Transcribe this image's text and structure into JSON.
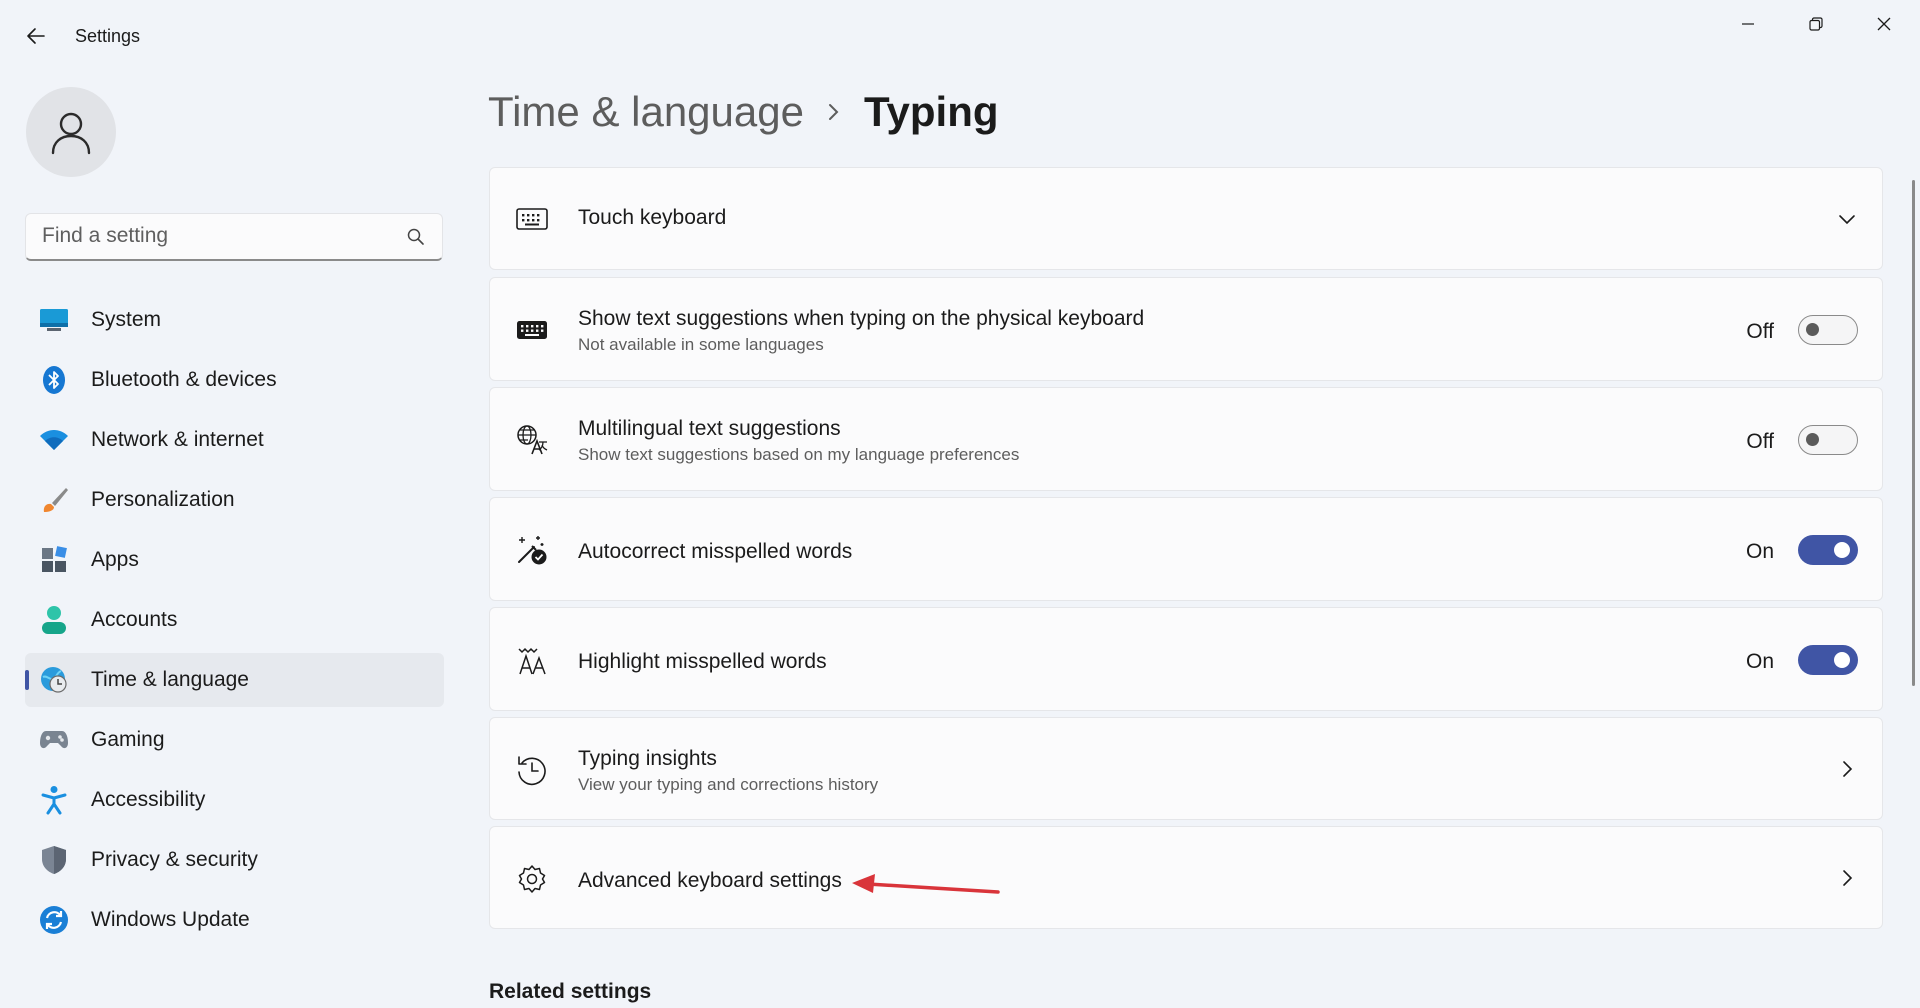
{
  "window": {
    "title": "Settings",
    "controls": [
      "minimize",
      "maximize",
      "close"
    ]
  },
  "search": {
    "placeholder": "Find a setting"
  },
  "sidebar": {
    "active": "Time & language",
    "items": [
      {
        "label": "System",
        "icon": "system-icon"
      },
      {
        "label": "Bluetooth & devices",
        "icon": "bluetooth-icon"
      },
      {
        "label": "Network & internet",
        "icon": "wifi-icon"
      },
      {
        "label": "Personalization",
        "icon": "brush-icon"
      },
      {
        "label": "Apps",
        "icon": "apps-icon"
      },
      {
        "label": "Accounts",
        "icon": "accounts-icon"
      },
      {
        "label": "Time & language",
        "icon": "time-language-icon"
      },
      {
        "label": "Gaming",
        "icon": "gamepad-icon"
      },
      {
        "label": "Accessibility",
        "icon": "accessibility-icon"
      },
      {
        "label": "Privacy & security",
        "icon": "shield-icon"
      },
      {
        "label": "Windows Update",
        "icon": "update-icon"
      }
    ]
  },
  "breadcrumb": {
    "parent": "Time & language",
    "current": "Typing"
  },
  "settings": [
    {
      "title": "Touch keyboard",
      "icon": "touch-keyboard-icon",
      "control": "expand"
    },
    {
      "title": "Show text suggestions when typing on the physical keyboard",
      "subtitle": "Not available in some languages",
      "icon": "keyboard-icon",
      "control": "toggle",
      "state": "Off"
    },
    {
      "title": "Multilingual text suggestions",
      "subtitle": "Show text suggestions based on my language preferences",
      "icon": "language-icon",
      "control": "toggle",
      "state": "Off"
    },
    {
      "title": "Autocorrect misspelled words",
      "icon": "autocorrect-icon",
      "control": "toggle",
      "state": "On"
    },
    {
      "title": "Highlight misspelled words",
      "icon": "highlight-spelling-icon",
      "control": "toggle",
      "state": "On"
    },
    {
      "title": "Typing insights",
      "subtitle": "View your typing and corrections history",
      "icon": "history-icon",
      "control": "chevron"
    },
    {
      "title": "Advanced keyboard settings",
      "icon": "gear-icon",
      "control": "chevron"
    }
  ],
  "related": {
    "heading": "Related settings"
  },
  "colors": {
    "accent": "#4055a5",
    "annotation_arrow": "#d9343a",
    "background": "#f1f4f9",
    "card": "#fbfbfc"
  }
}
